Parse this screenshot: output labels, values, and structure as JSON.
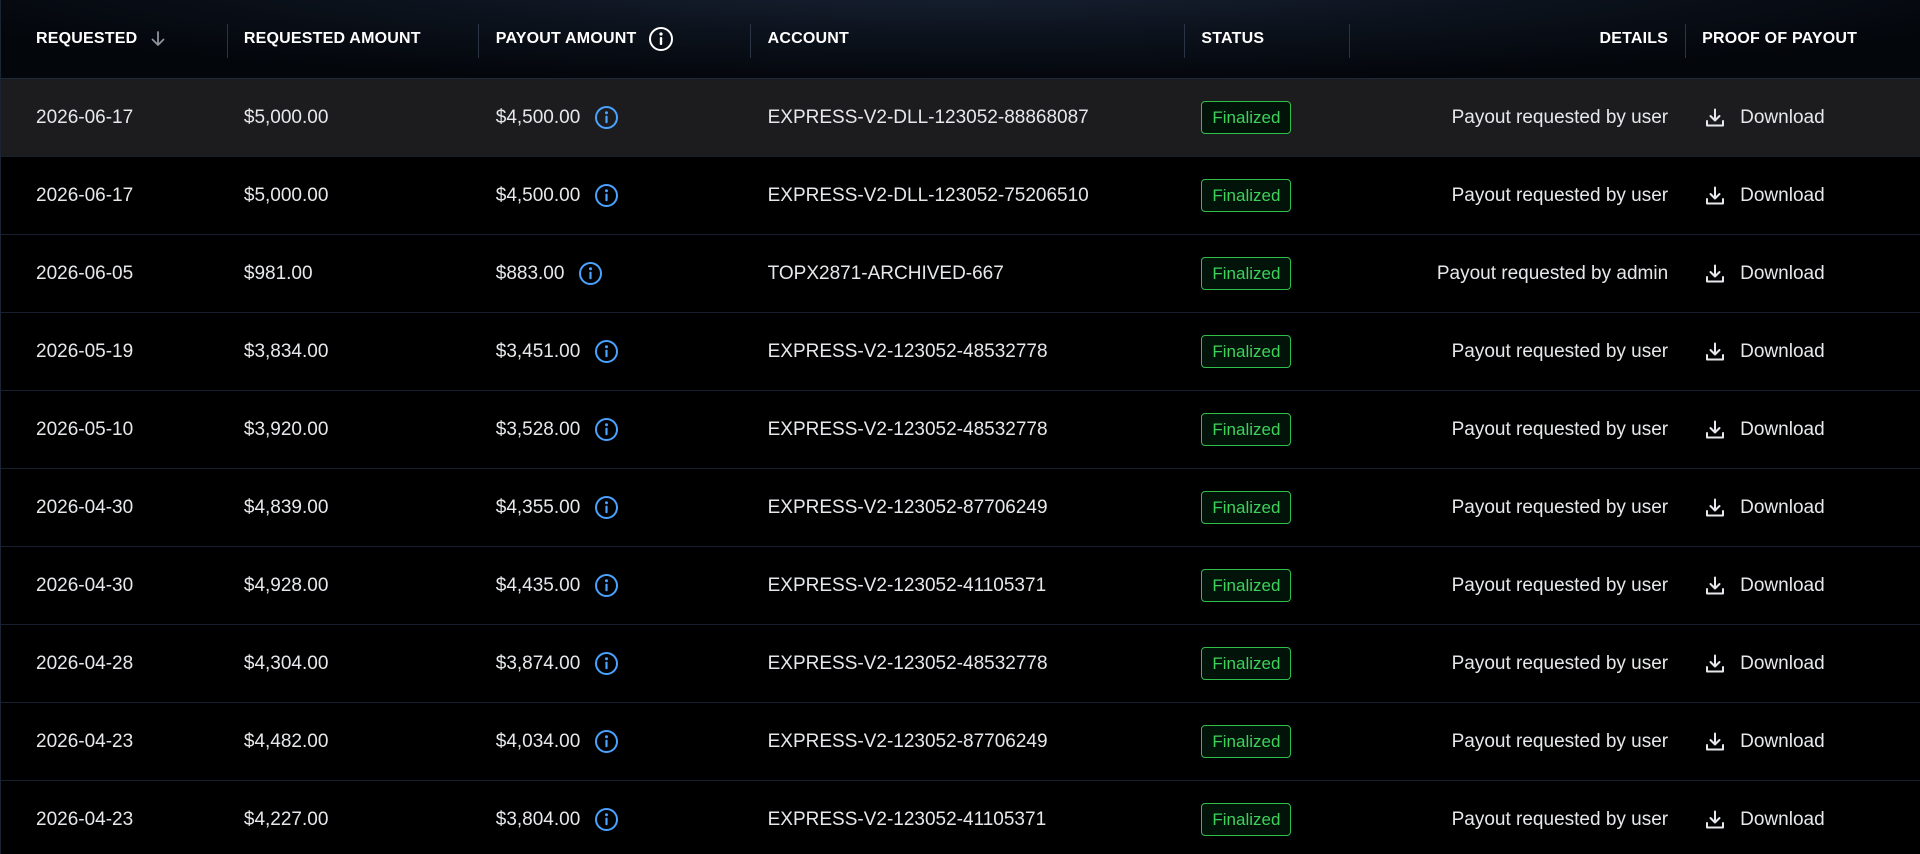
{
  "headers": {
    "requested": "REQUESTED",
    "requested_amount": "REQUESTED AMOUNT",
    "payout_amount": "PAYOUT AMOUNT",
    "account": "ACCOUNT",
    "status": "STATUS",
    "details": "DETAILS",
    "proof": "PROOF OF PAYOUT"
  },
  "icons": {
    "sort": "arrow-down-icon",
    "info": "info-circle-icon",
    "download": "download-icon"
  },
  "colors": {
    "status_green": "#3ed25a",
    "info_blue": "#4aa3ff",
    "highlight_row": "#1c1c1e"
  },
  "rows": [
    {
      "date": "2026-06-17",
      "requested": "$5,000.00",
      "payout": "$4,500.00",
      "account": "EXPRESS-V2-DLL-123052-88868087",
      "status": "Finalized",
      "details": "Payout requested by user",
      "proof": "Download"
    },
    {
      "date": "2026-06-17",
      "requested": "$5,000.00",
      "payout": "$4,500.00",
      "account": "EXPRESS-V2-DLL-123052-75206510",
      "status": "Finalized",
      "details": "Payout requested by user",
      "proof": "Download"
    },
    {
      "date": "2026-06-05",
      "requested": "$981.00",
      "payout": "$883.00",
      "account": "TOPX2871-ARCHIVED-667",
      "status": "Finalized",
      "details": "Payout requested by admin",
      "proof": "Download"
    },
    {
      "date": "2026-05-19",
      "requested": "$3,834.00",
      "payout": "$3,451.00",
      "account": "EXPRESS-V2-123052-48532778",
      "status": "Finalized",
      "details": "Payout requested by user",
      "proof": "Download"
    },
    {
      "date": "2026-05-10",
      "requested": "$3,920.00",
      "payout": "$3,528.00",
      "account": "EXPRESS-V2-123052-48532778",
      "status": "Finalized",
      "details": "Payout requested by user",
      "proof": "Download"
    },
    {
      "date": "2026-04-30",
      "requested": "$4,839.00",
      "payout": "$4,355.00",
      "account": "EXPRESS-V2-123052-87706249",
      "status": "Finalized",
      "details": "Payout requested by user",
      "proof": "Download"
    },
    {
      "date": "2026-04-30",
      "requested": "$4,928.00",
      "payout": "$4,435.00",
      "account": "EXPRESS-V2-123052-41105371",
      "status": "Finalized",
      "details": "Payout requested by user",
      "proof": "Download"
    },
    {
      "date": "2026-04-28",
      "requested": "$4,304.00",
      "payout": "$3,874.00",
      "account": "EXPRESS-V2-123052-48532778",
      "status": "Finalized",
      "details": "Payout requested by user",
      "proof": "Download"
    },
    {
      "date": "2026-04-23",
      "requested": "$4,482.00",
      "payout": "$4,034.00",
      "account": "EXPRESS-V2-123052-87706249",
      "status": "Finalized",
      "details": "Payout requested by user",
      "proof": "Download"
    },
    {
      "date": "2026-04-23",
      "requested": "$4,227.00",
      "payout": "$3,804.00",
      "account": "EXPRESS-V2-123052-41105371",
      "status": "Finalized",
      "details": "Payout requested by user",
      "proof": "Download"
    }
  ]
}
